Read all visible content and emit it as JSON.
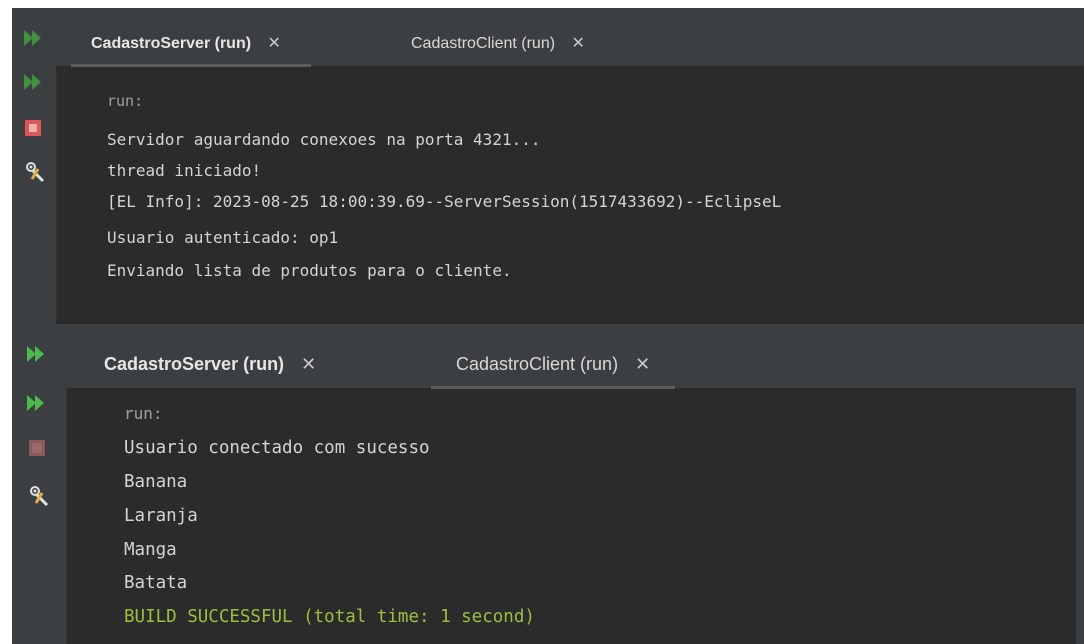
{
  "top_panel": {
    "tabs": [
      {
        "label": "CadastroServer (run)",
        "close": "✕",
        "active": true
      },
      {
        "label": "CadastroClient (run)",
        "close": "✕",
        "active": false
      }
    ],
    "sidebar_icons": [
      "rerun-icon",
      "rerun-icon",
      "stop-icon",
      "settings-icon"
    ],
    "output": [
      "run:",
      "Servidor aguardando conexoes na porta 4321...",
      "thread iniciado!",
      "[EL Info]: 2023-08-25 18:00:39.69--ServerSession(1517433692)--EclipseL",
      "Usuario autenticado: op1",
      "Enviando lista de produtos para o cliente."
    ]
  },
  "bottom_panel": {
    "tabs": [
      {
        "label": "CadastroServer (run)",
        "close": "✕",
        "active": true
      },
      {
        "label": "CadastroClient (run)",
        "close": "✕",
        "active": false
      }
    ],
    "sidebar_icons": [
      "rerun-icon",
      "rerun-icon",
      "stop-icon",
      "settings-icon"
    ],
    "output": [
      "run:",
      "Usuario conectado com sucesso",
      "Banana",
      "Laranja",
      "Manga",
      "Batata",
      "BUILD SUCCESSFUL (total time: 1 second)"
    ]
  },
  "colors": {
    "console_bg": "#2b2b2b",
    "panel_bg": "#3c3f41",
    "text": "#d4d4d4",
    "success": "#9cbf3e",
    "run_icon": "#4fb84f",
    "stop_icon_active": "#e05555",
    "stop_icon_inactive": "#8a5b5b"
  }
}
